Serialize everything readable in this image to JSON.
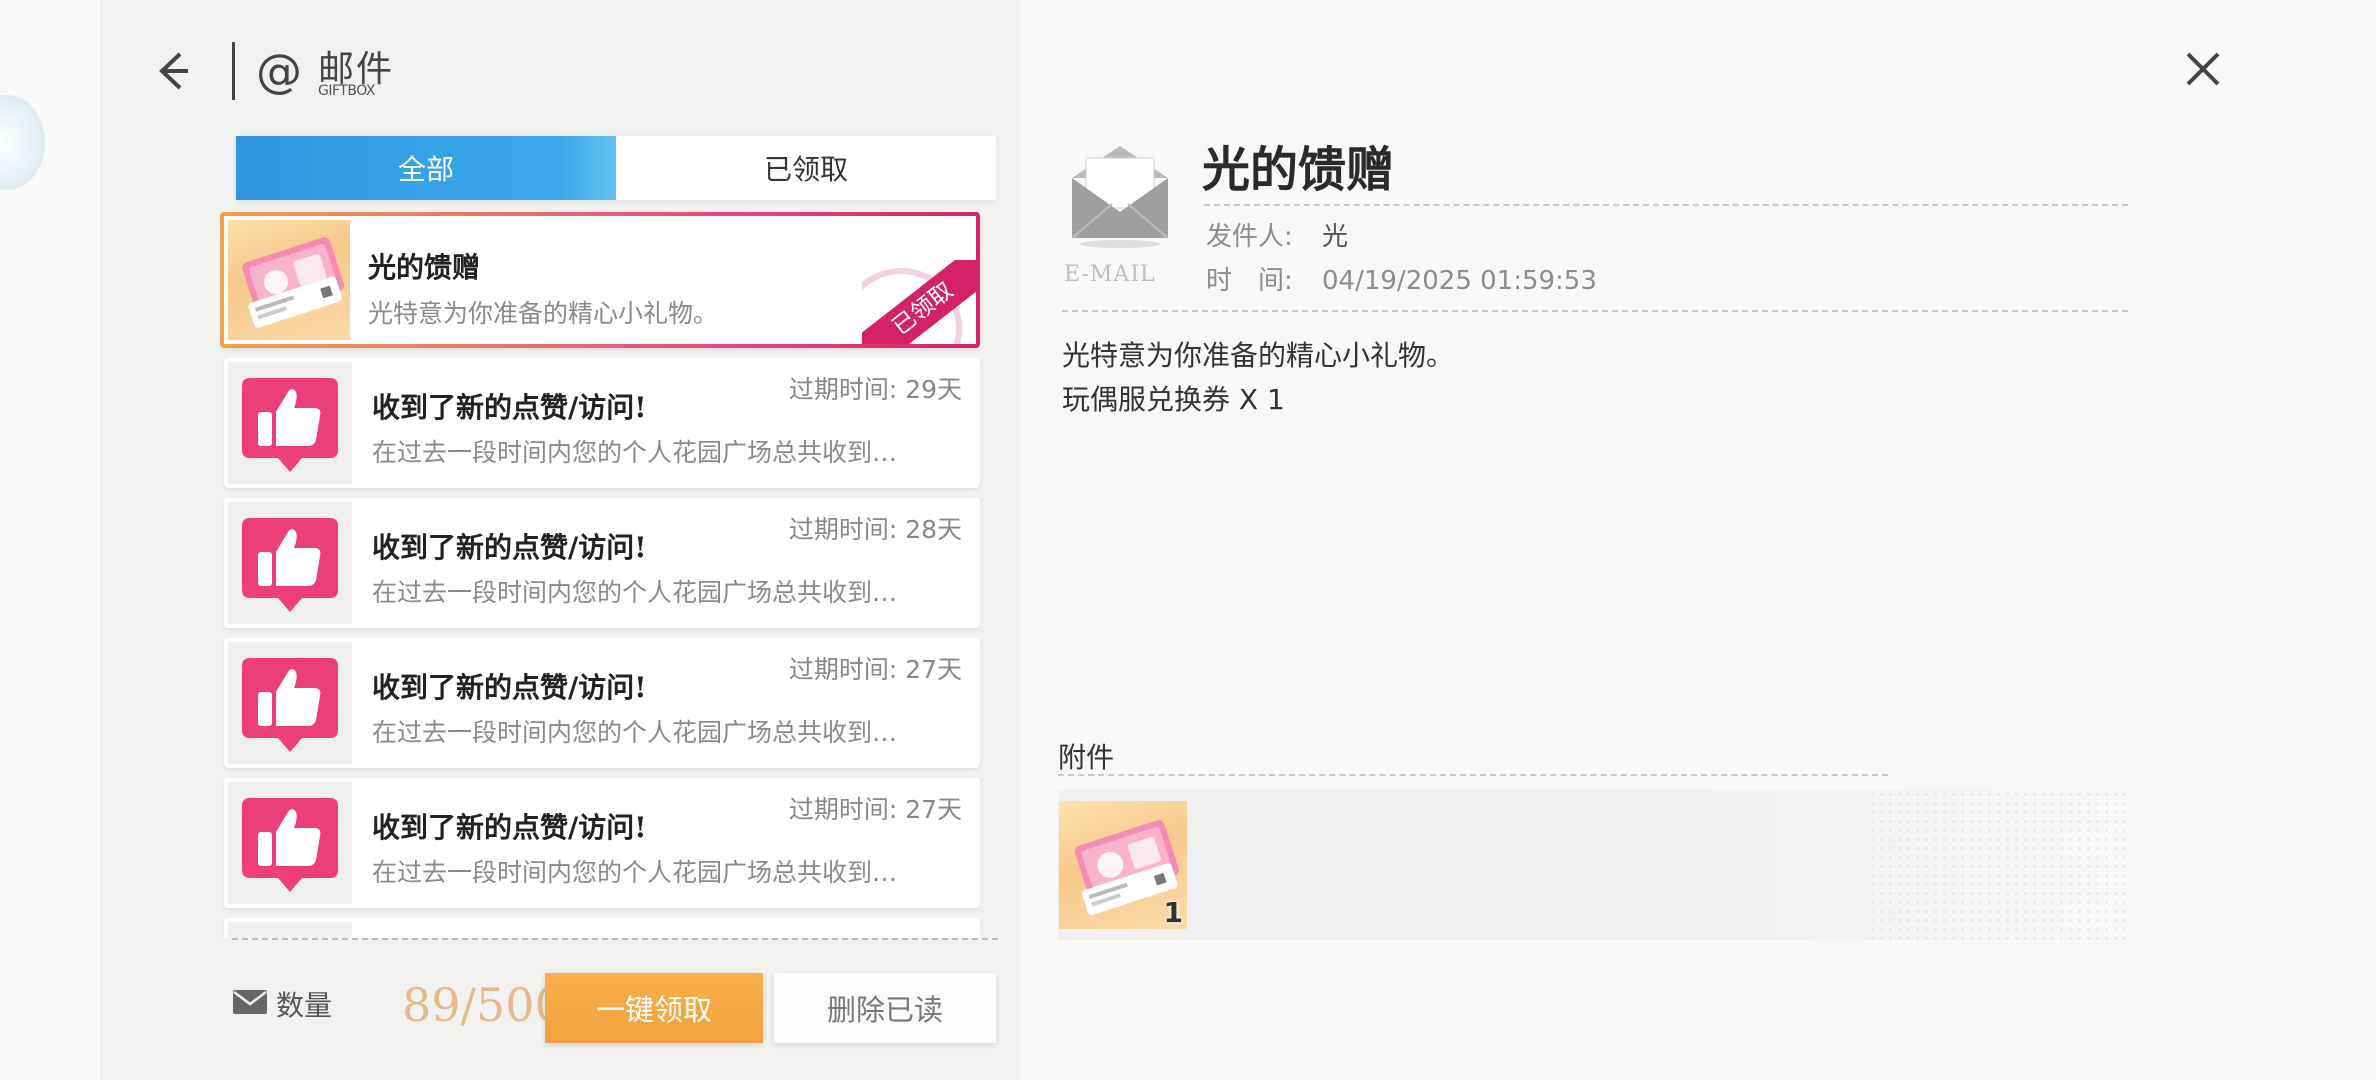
{
  "header": {
    "title": "邮件",
    "subtitle": "GIFTBOX"
  },
  "tabs": [
    {
      "label": "全部",
      "active": true
    },
    {
      "label": "已领取",
      "active": false
    }
  ],
  "mails": [
    {
      "title": "光的馈赠",
      "preview": "光特意为你准备的精心小礼物。",
      "expire": "",
      "stamp": "已领取",
      "icon": "voucher-ticket-icon",
      "selected": true
    },
    {
      "title": "收到了新的点赞/访问!",
      "preview": "在过去一段时间内您的个人花园广场总共收到…",
      "expire": "过期时间: 29天",
      "icon": "thumbs-up-icon"
    },
    {
      "title": "收到了新的点赞/访问!",
      "preview": "在过去一段时间内您的个人花园广场总共收到…",
      "expire": "过期时间: 28天",
      "icon": "thumbs-up-icon"
    },
    {
      "title": "收到了新的点赞/访问!",
      "preview": "在过去一段时间内您的个人花园广场总共收到…",
      "expire": "过期时间: 27天",
      "icon": "thumbs-up-icon"
    },
    {
      "title": "收到了新的点赞/访问!",
      "preview": "在过去一段时间内您的个人花园广场总共收到…",
      "expire": "过期时间: 27天",
      "icon": "thumbs-up-icon"
    }
  ],
  "footer": {
    "count_label": "数量",
    "count_value": "89/500",
    "claim_all": "一键领取",
    "delete_read": "删除已读"
  },
  "detail": {
    "email_word": "E-MAIL",
    "title": "光的馈赠",
    "sender_label": "发件人:",
    "sender": "光",
    "time_label": "时　间:",
    "time": "04/19/2025 01:59:53",
    "body": [
      "光特意为你准备的精心小礼物。",
      "玩偶服兑换券 X 1"
    ],
    "attachments_label": "附件",
    "attachments": [
      {
        "icon": "voucher-ticket-icon",
        "qty": "1"
      }
    ]
  },
  "colors": {
    "tab_active": "#2f96e0",
    "claim_button": "#f4a640",
    "selected_border": "#e5396f",
    "stamp": "#d52266",
    "thumb_icon": "#ec3e78"
  }
}
